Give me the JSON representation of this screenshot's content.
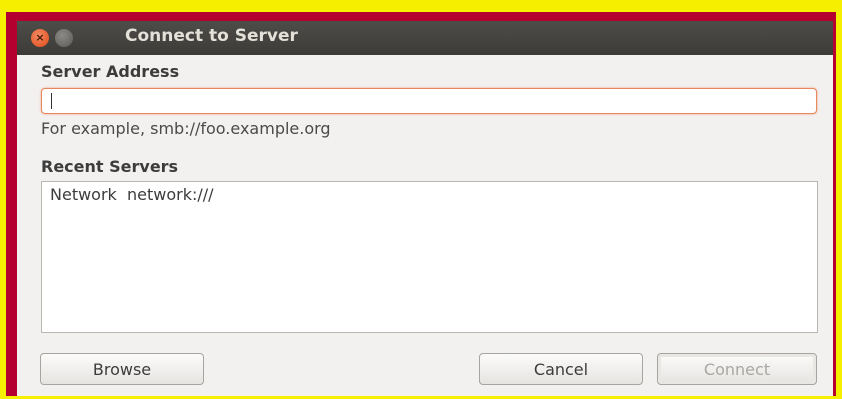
{
  "window": {
    "title": "Connect to Server",
    "close_glyph": "×"
  },
  "server_address": {
    "label": "Server Address",
    "value": "",
    "hint": "For example, smb://foo.example.org"
  },
  "recent_servers": {
    "label": "Recent Servers",
    "items": [
      {
        "name": "Network",
        "uri": "network:///"
      }
    ]
  },
  "buttons": {
    "browse": "Browse",
    "cancel": "Cancel",
    "connect": "Connect"
  },
  "colors": {
    "outer_frame": "#f7ef00",
    "inner_frame": "#b4002e",
    "titlebar": "#3c3b37",
    "focus_border": "#e6875e"
  }
}
